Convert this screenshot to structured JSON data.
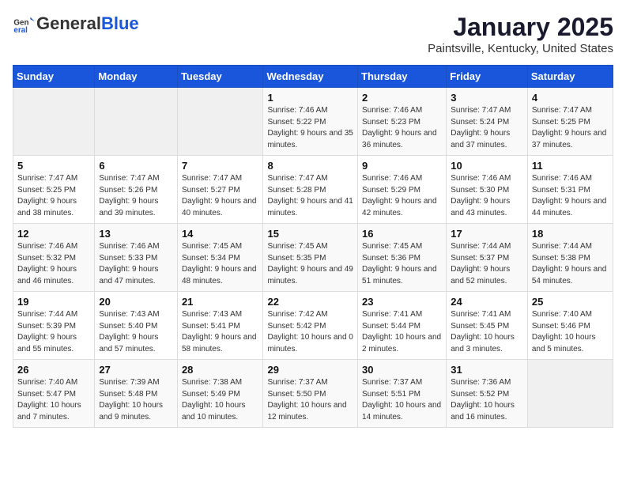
{
  "header": {
    "logo_general": "General",
    "logo_blue": "Blue",
    "month_title": "January 2025",
    "subtitle": "Paintsville, Kentucky, United States"
  },
  "weekdays": [
    "Sunday",
    "Monday",
    "Tuesday",
    "Wednesday",
    "Thursday",
    "Friday",
    "Saturday"
  ],
  "weeks": [
    [
      {
        "day": "",
        "empty": true
      },
      {
        "day": "",
        "empty": true
      },
      {
        "day": "",
        "empty": true
      },
      {
        "day": "1",
        "sunrise": "7:46 AM",
        "sunset": "5:22 PM",
        "daylight": "9 hours and 35 minutes."
      },
      {
        "day": "2",
        "sunrise": "7:46 AM",
        "sunset": "5:23 PM",
        "daylight": "9 hours and 36 minutes."
      },
      {
        "day": "3",
        "sunrise": "7:47 AM",
        "sunset": "5:24 PM",
        "daylight": "9 hours and 37 minutes."
      },
      {
        "day": "4",
        "sunrise": "7:47 AM",
        "sunset": "5:25 PM",
        "daylight": "9 hours and 37 minutes."
      }
    ],
    [
      {
        "day": "5",
        "sunrise": "7:47 AM",
        "sunset": "5:25 PM",
        "daylight": "9 hours and 38 minutes."
      },
      {
        "day": "6",
        "sunrise": "7:47 AM",
        "sunset": "5:26 PM",
        "daylight": "9 hours and 39 minutes."
      },
      {
        "day": "7",
        "sunrise": "7:47 AM",
        "sunset": "5:27 PM",
        "daylight": "9 hours and 40 minutes."
      },
      {
        "day": "8",
        "sunrise": "7:47 AM",
        "sunset": "5:28 PM",
        "daylight": "9 hours and 41 minutes."
      },
      {
        "day": "9",
        "sunrise": "7:46 AM",
        "sunset": "5:29 PM",
        "daylight": "9 hours and 42 minutes."
      },
      {
        "day": "10",
        "sunrise": "7:46 AM",
        "sunset": "5:30 PM",
        "daylight": "9 hours and 43 minutes."
      },
      {
        "day": "11",
        "sunrise": "7:46 AM",
        "sunset": "5:31 PM",
        "daylight": "9 hours and 44 minutes."
      }
    ],
    [
      {
        "day": "12",
        "sunrise": "7:46 AM",
        "sunset": "5:32 PM",
        "daylight": "9 hours and 46 minutes."
      },
      {
        "day": "13",
        "sunrise": "7:46 AM",
        "sunset": "5:33 PM",
        "daylight": "9 hours and 47 minutes."
      },
      {
        "day": "14",
        "sunrise": "7:45 AM",
        "sunset": "5:34 PM",
        "daylight": "9 hours and 48 minutes."
      },
      {
        "day": "15",
        "sunrise": "7:45 AM",
        "sunset": "5:35 PM",
        "daylight": "9 hours and 49 minutes."
      },
      {
        "day": "16",
        "sunrise": "7:45 AM",
        "sunset": "5:36 PM",
        "daylight": "9 hours and 51 minutes."
      },
      {
        "day": "17",
        "sunrise": "7:44 AM",
        "sunset": "5:37 PM",
        "daylight": "9 hours and 52 minutes."
      },
      {
        "day": "18",
        "sunrise": "7:44 AM",
        "sunset": "5:38 PM",
        "daylight": "9 hours and 54 minutes."
      }
    ],
    [
      {
        "day": "19",
        "sunrise": "7:44 AM",
        "sunset": "5:39 PM",
        "daylight": "9 hours and 55 minutes."
      },
      {
        "day": "20",
        "sunrise": "7:43 AM",
        "sunset": "5:40 PM",
        "daylight": "9 hours and 57 minutes."
      },
      {
        "day": "21",
        "sunrise": "7:43 AM",
        "sunset": "5:41 PM",
        "daylight": "9 hours and 58 minutes."
      },
      {
        "day": "22",
        "sunrise": "7:42 AM",
        "sunset": "5:42 PM",
        "daylight": "10 hours and 0 minutes."
      },
      {
        "day": "23",
        "sunrise": "7:41 AM",
        "sunset": "5:44 PM",
        "daylight": "10 hours and 2 minutes."
      },
      {
        "day": "24",
        "sunrise": "7:41 AM",
        "sunset": "5:45 PM",
        "daylight": "10 hours and 3 minutes."
      },
      {
        "day": "25",
        "sunrise": "7:40 AM",
        "sunset": "5:46 PM",
        "daylight": "10 hours and 5 minutes."
      }
    ],
    [
      {
        "day": "26",
        "sunrise": "7:40 AM",
        "sunset": "5:47 PM",
        "daylight": "10 hours and 7 minutes."
      },
      {
        "day": "27",
        "sunrise": "7:39 AM",
        "sunset": "5:48 PM",
        "daylight": "10 hours and 9 minutes."
      },
      {
        "day": "28",
        "sunrise": "7:38 AM",
        "sunset": "5:49 PM",
        "daylight": "10 hours and 10 minutes."
      },
      {
        "day": "29",
        "sunrise": "7:37 AM",
        "sunset": "5:50 PM",
        "daylight": "10 hours and 12 minutes."
      },
      {
        "day": "30",
        "sunrise": "7:37 AM",
        "sunset": "5:51 PM",
        "daylight": "10 hours and 14 minutes."
      },
      {
        "day": "31",
        "sunrise": "7:36 AM",
        "sunset": "5:52 PM",
        "daylight": "10 hours and 16 minutes."
      },
      {
        "day": "",
        "empty": true
      }
    ]
  ]
}
